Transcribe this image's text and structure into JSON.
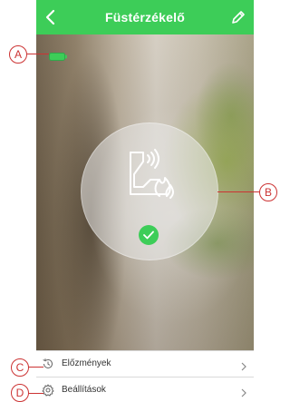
{
  "header": {
    "title": "Füstérzékelő",
    "back_icon": "chevron-left-icon",
    "edit_icon": "pencil-icon",
    "background_color": "#3dcd58"
  },
  "device": {
    "battery_icon": "battery-full-icon",
    "battery_color": "#3dcd58",
    "status_icon": "smoke-detector-icon",
    "status_ok_icon": "check-icon"
  },
  "menu": {
    "items": [
      {
        "label": "Előzmények",
        "icon": "history-icon"
      },
      {
        "label": "Beállítások",
        "icon": "gear-icon"
      }
    ]
  },
  "callouts": {
    "a": "A",
    "b": "B",
    "c": "C",
    "d": "D",
    "color": "#cc3333"
  }
}
